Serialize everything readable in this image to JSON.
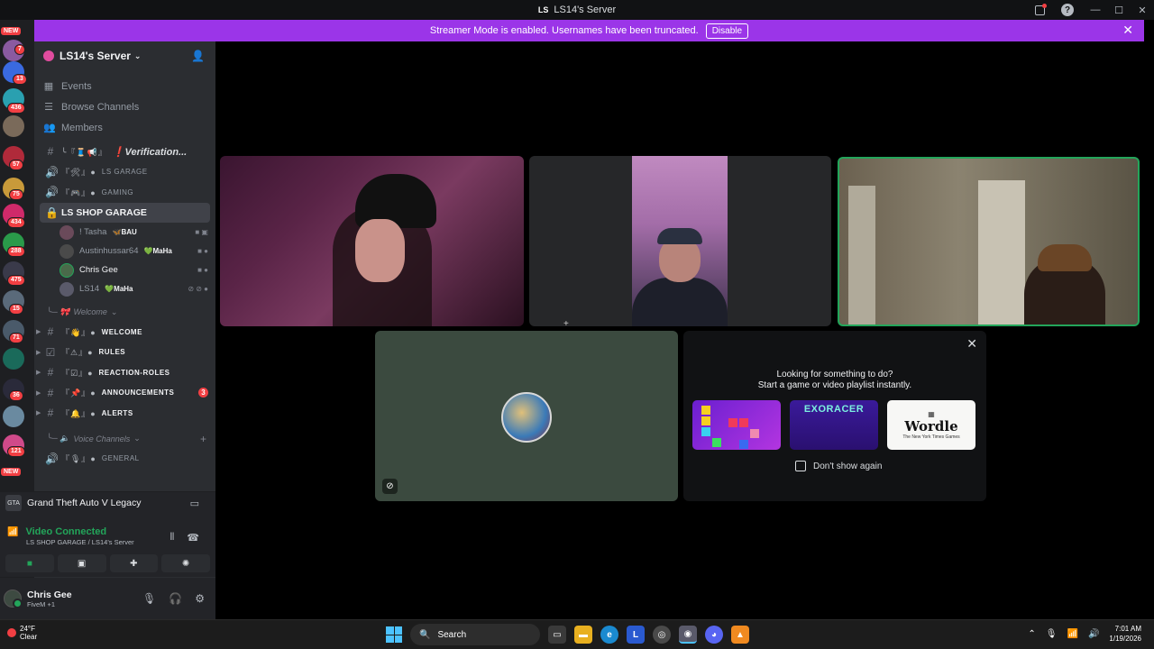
{
  "window": {
    "title": "LS14's Server",
    "logo_text": "LS"
  },
  "banner": {
    "text": "Streamer Mode is enabled. Usernames have been truncated.",
    "button": "Disable"
  },
  "rail": {
    "badges": [
      "7",
      "13",
      "436",
      "57",
      "75",
      "434",
      "288",
      "475",
      "15",
      "71",
      "36",
      "121"
    ],
    "new_label": "NEW"
  },
  "server": {
    "name": "LS14's Server"
  },
  "nav": [
    {
      "label": "Events",
      "icon": "calendar-icon"
    },
    {
      "label": "Browse Channels",
      "icon": "browse-icon"
    },
    {
      "label": "Members",
      "icon": "members-icon"
    }
  ],
  "channels_top": [
    {
      "deco": "╰『🧵📢』",
      "name": "❗Verification...",
      "style": "italic",
      "icon": "#"
    },
    {
      "deco": "『🛠』●",
      "name": "LS GARAGE",
      "style": "small",
      "icon": "speaker"
    },
    {
      "deco": "『🎮』●",
      "name": "GAMING",
      "style": "small",
      "icon": "speaker"
    }
  ],
  "active_voice": {
    "name": "LS SHOP GARAGE"
  },
  "voice_users": [
    {
      "name": "! Tasha",
      "tag": "BAU",
      "tag_prefix": "🦋"
    },
    {
      "name": "Austinhussar64",
      "tag": "MaHa",
      "tag_prefix": "💚"
    },
    {
      "name": "Chris Gee",
      "tag": "",
      "tag_prefix": ""
    },
    {
      "name": "LS14",
      "tag": "MaHa",
      "tag_prefix": "💚"
    }
  ],
  "category_welcome": "Welcome",
  "text_channels": [
    {
      "deco": "『👋』●",
      "name": "WELCOME",
      "ping": ""
    },
    {
      "deco": "『⚠』●",
      "name": "RULES",
      "ping": ""
    },
    {
      "deco": "『☑』●",
      "name": "REACTION-ROLES",
      "ping": ""
    },
    {
      "deco": "『📌』●",
      "name": "ANNOUNCEMENTS",
      "ping": "3"
    },
    {
      "deco": "『🔔』●",
      "name": "ALERTS",
      "ping": ""
    }
  ],
  "category_voice": "Voice Channels",
  "general_channel": {
    "deco": "『🎙』●",
    "name": "GENERAL"
  },
  "activity": {
    "game": "Grand Theft Auto V Legacy",
    "game_icon_text": "GTA"
  },
  "voice_status": {
    "title": "Video Connected",
    "location": "LS SHOP GARAGE / LS14's Server"
  },
  "user": {
    "name": "Chris Gee",
    "status": "FiveM +1"
  },
  "suggest": {
    "line1": "Looking for something to do?",
    "line2": "Start a game or video playlist instantly.",
    "games": [
      "Tetris",
      "EXORACER",
      "Wordle"
    ],
    "wordle_sub": "The New York Times Games",
    "checkbox_label": "Don't show again"
  },
  "taskbar": {
    "temp": "24°F",
    "weather": "Clear",
    "search": "Search",
    "time": "7:01 AM",
    "date": "1/19/2026"
  },
  "colors": {
    "banner": "#9b35e8",
    "speaking": "#23a55a",
    "badge": "#f23f43"
  }
}
